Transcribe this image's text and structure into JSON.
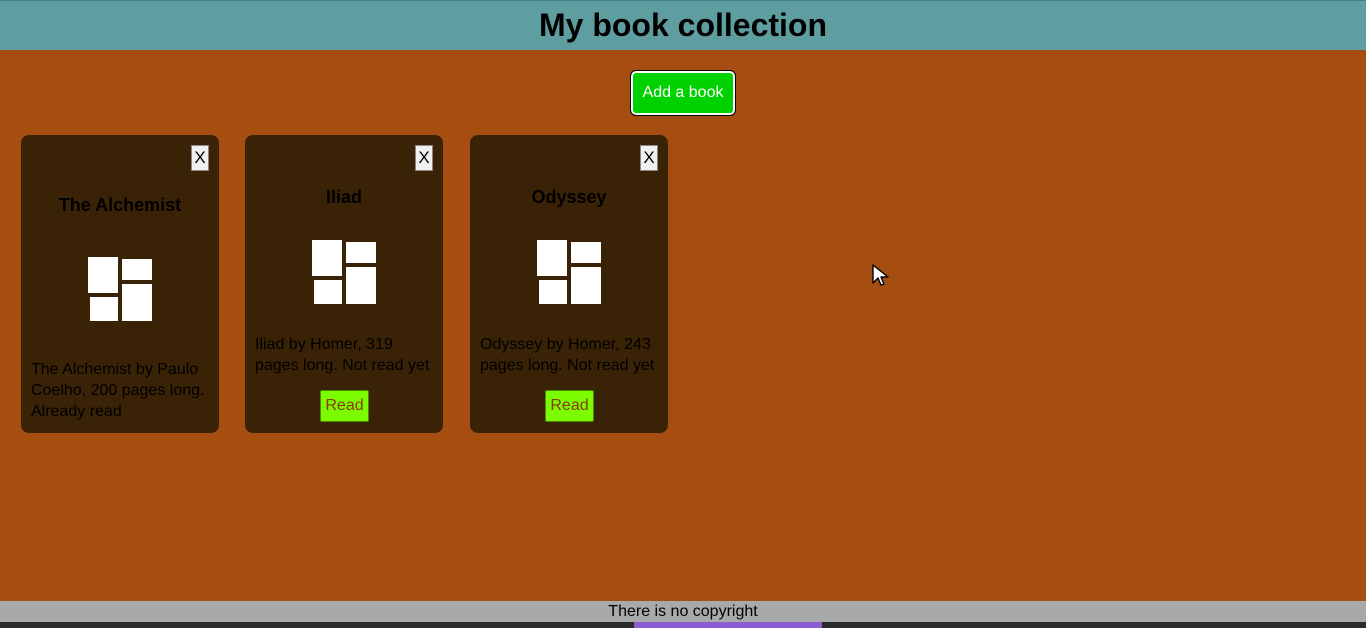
{
  "header": {
    "title": "My book collection"
  },
  "toolbar": {
    "add_label": "Add a book"
  },
  "books": [
    {
      "title": "The Alchemist",
      "description": "The Alchemist by Paulo Coelho, 200 pages long. Already read",
      "close_label": "X",
      "read_label": ""
    },
    {
      "title": "Iliad",
      "description": "Iliad by Homer, 319 pages long. Not read yet",
      "close_label": "X",
      "read_label": "Read"
    },
    {
      "title": "Odyssey",
      "description": "Odyssey by Homer, 243 pages long. Not read yet",
      "close_label": "X",
      "read_label": "Read"
    }
  ],
  "footer": {
    "text": "There is no copyright"
  },
  "icons": {
    "cover": "book-cover-icon",
    "close": "close-icon",
    "cursor": "mouse-cursor-icon"
  },
  "colors": {
    "background": "#a64d12",
    "header": "#5f9ea0",
    "card": "#3a2206",
    "add_button": "#00d100",
    "read_button": "#7cfc00",
    "footer": "#a9a9a9"
  }
}
